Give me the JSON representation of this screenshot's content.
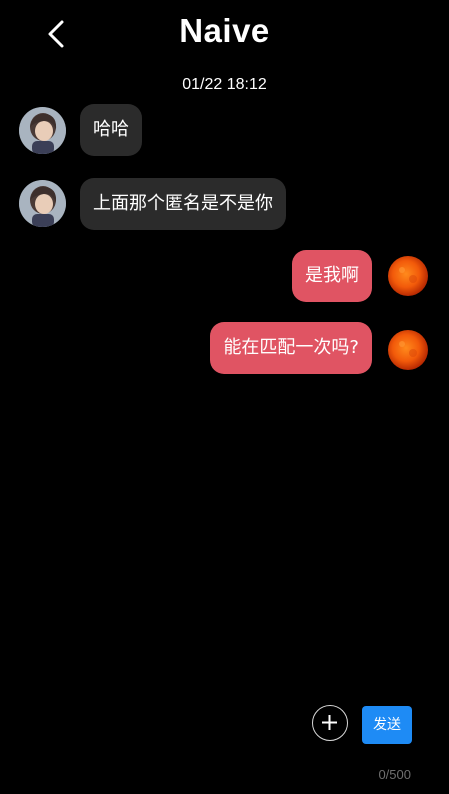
{
  "header": {
    "title": "Naive"
  },
  "conversation": {
    "timestamp": "01/22 18:12",
    "messages": [
      {
        "direction": "incoming",
        "text": "哈哈"
      },
      {
        "direction": "incoming",
        "text": "上面那个匿名是不是你"
      },
      {
        "direction": "outgoing",
        "text": "是我啊"
      },
      {
        "direction": "outgoing",
        "text": "能在匹配一次吗?"
      }
    ]
  },
  "composer": {
    "send_label": "发送",
    "char_counter": "0/500"
  },
  "colors": {
    "incoming_bubble": "#2b2b2b",
    "outgoing_bubble": "#e05463",
    "send_button": "#1e8bf5"
  }
}
